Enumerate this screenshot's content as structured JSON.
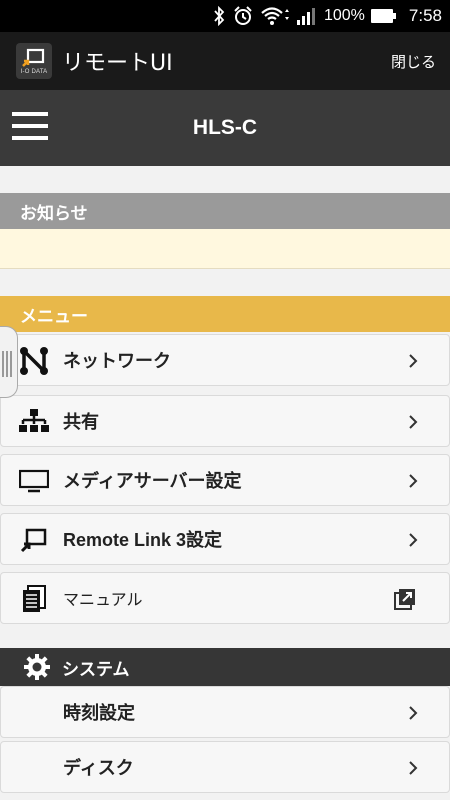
{
  "status_bar": {
    "battery_text": "100%",
    "time": "7:58",
    "icons": [
      "bluetooth-icon",
      "alarm-icon",
      "wifi-icon",
      "signal-icon",
      "battery-icon"
    ]
  },
  "app_bar": {
    "logo_text": "I-O DATA",
    "title": "リモートUI",
    "close_label": "閉じる"
  },
  "nav": {
    "title": "HLS-C"
  },
  "notice": {
    "header": "お知らせ"
  },
  "menu": {
    "header": "メニュー",
    "items": [
      {
        "label": "ネットワーク",
        "icon": "network-icon",
        "action": "chevron"
      },
      {
        "label": "共有",
        "icon": "share-tree-icon",
        "action": "chevron"
      },
      {
        "label": "メディアサーバー設定",
        "icon": "monitor-icon",
        "action": "chevron"
      },
      {
        "label": "Remote Link 3設定",
        "icon": "remote-link-icon",
        "action": "chevron"
      },
      {
        "label": "マニュアル",
        "icon": "manual-icon",
        "action": "external"
      }
    ]
  },
  "system": {
    "header": "システム",
    "items": [
      {
        "label": "時刻設定",
        "action": "chevron"
      },
      {
        "label": "ディスク",
        "action": "chevron"
      }
    ]
  },
  "colors": {
    "menu_header": "#e8b84a",
    "notice_header": "#9a9a9a",
    "notice_body": "#fff8df",
    "system_header": "#363636",
    "navbar": "#3a3a3a"
  }
}
